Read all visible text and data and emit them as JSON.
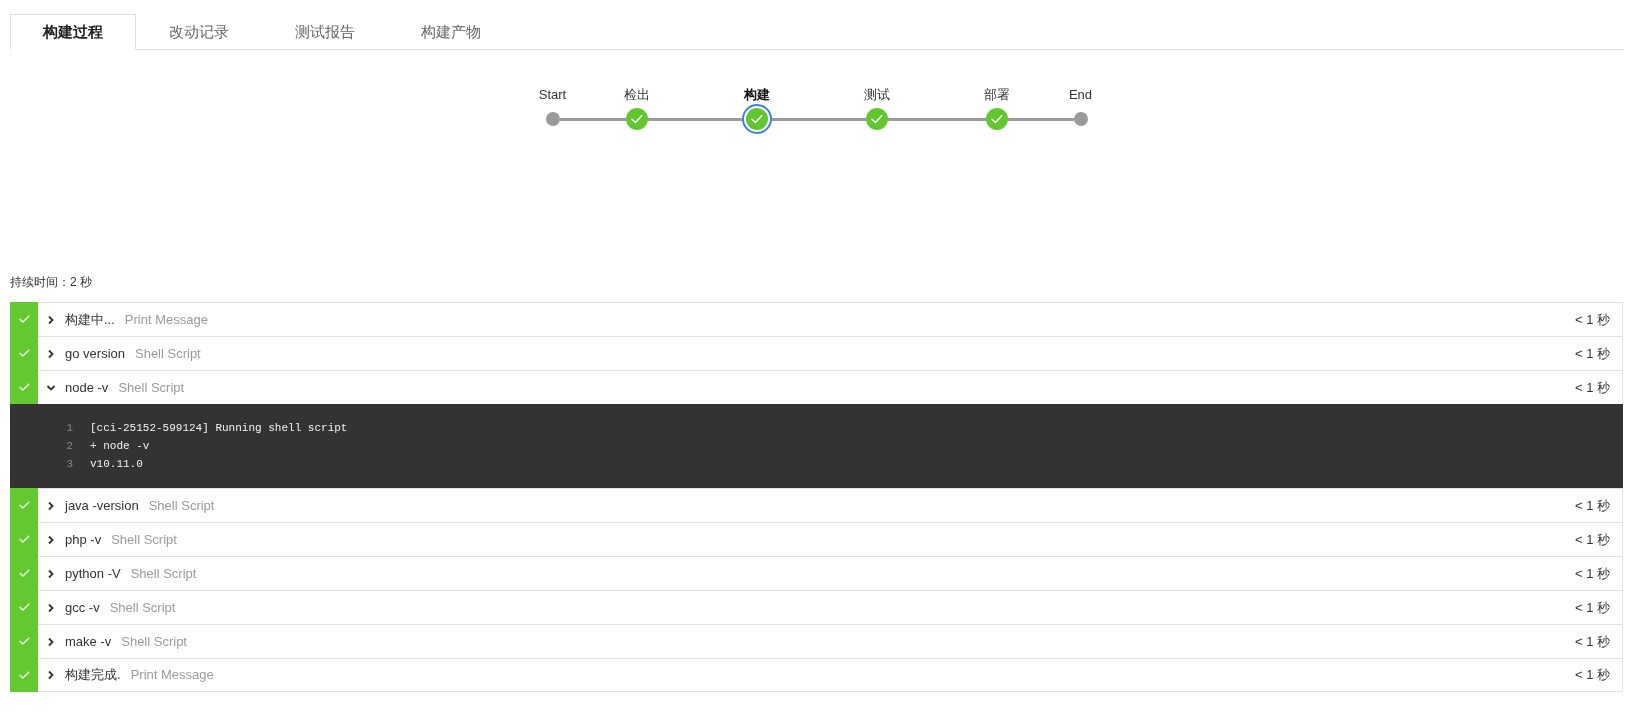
{
  "tabs": [
    {
      "label": "构建过程",
      "selected": true
    },
    {
      "label": "改动记录",
      "selected": false
    },
    {
      "label": "测试报告",
      "selected": false
    },
    {
      "label": "构建产物",
      "selected": false
    }
  ],
  "pipeline": [
    {
      "label": "Start",
      "kind": "terminal",
      "selected": false
    },
    {
      "label": "检出",
      "kind": "stage",
      "passed": true,
      "selected": false
    },
    {
      "label": "构建",
      "kind": "stage",
      "passed": true,
      "selected": true
    },
    {
      "label": "测试",
      "kind": "stage",
      "passed": true,
      "selected": false
    },
    {
      "label": "部署",
      "kind": "stage",
      "passed": true,
      "selected": false
    },
    {
      "label": "End",
      "kind": "terminal",
      "selected": false
    }
  ],
  "duration": "持续时间：2 秒",
  "steps": [
    {
      "name": "构建中...",
      "type": "Print Message",
      "duration": "< 1 秒",
      "passed": true,
      "expanded": false
    },
    {
      "name": "go version",
      "type": "Shell Script",
      "duration": "< 1 秒",
      "passed": true,
      "expanded": false
    },
    {
      "name": "node -v",
      "type": "Shell Script",
      "duration": "< 1 秒",
      "passed": true,
      "expanded": true,
      "log": [
        {
          "number": "1",
          "text": "[cci-25152-599124] Running shell script"
        },
        {
          "number": "2",
          "text": "+ node -v"
        },
        {
          "number": "3",
          "text": "v10.11.0"
        }
      ]
    },
    {
      "name": "java -version",
      "type": "Shell Script",
      "duration": "< 1 秒",
      "passed": true,
      "expanded": false
    },
    {
      "name": "php -v",
      "type": "Shell Script",
      "duration": "< 1 秒",
      "passed": true,
      "expanded": false
    },
    {
      "name": "python -V",
      "type": "Shell Script",
      "duration": "< 1 秒",
      "passed": true,
      "expanded": false
    },
    {
      "name": "gcc -v",
      "type": "Shell Script",
      "duration": "< 1 秒",
      "passed": true,
      "expanded": false
    },
    {
      "name": "make -v",
      "type": "Shell Script",
      "duration": "< 1 秒",
      "passed": true,
      "expanded": false
    },
    {
      "name": "构建完成.",
      "type": "Print Message",
      "duration": "< 1 秒",
      "passed": true,
      "expanded": false
    }
  ]
}
